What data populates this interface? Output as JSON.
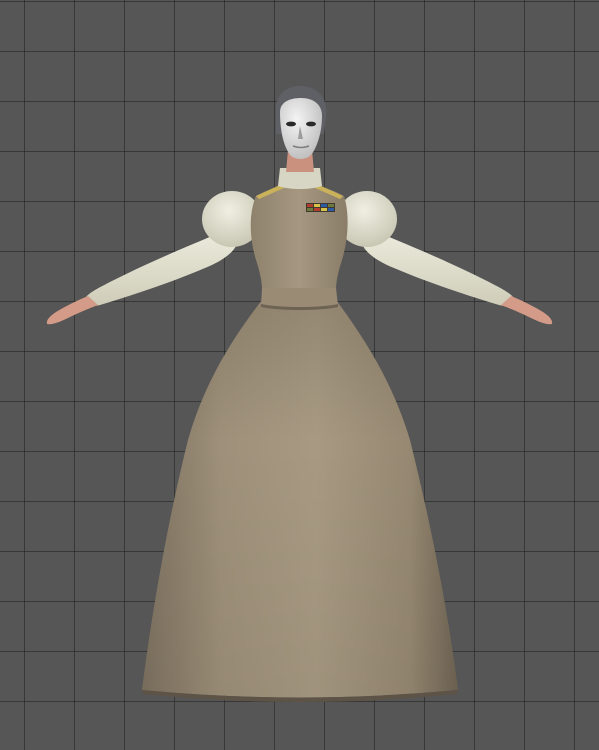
{
  "viewport": {
    "grid_visible": true,
    "background_color": "#565656",
    "grid_line_color": "#3c3c3c"
  },
  "model": {
    "pose": "T-pose",
    "colors": {
      "dress": "#9d8f78",
      "sleeve": "#e2e1cf",
      "skin": "#d9a28e",
      "mask": "#e4e4e4",
      "hair": "#5f5f66",
      "collar_trim": "#c9b25a",
      "rank_bar": "#6e7a3b"
    }
  }
}
